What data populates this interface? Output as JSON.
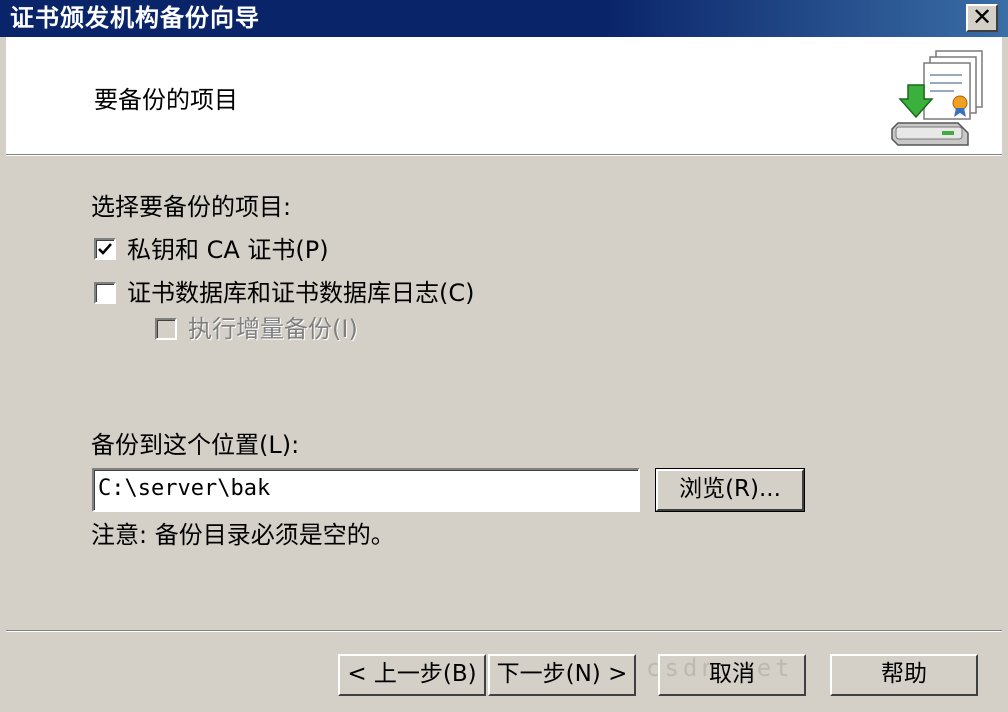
{
  "window": {
    "title": "证书颁发机构备份向导",
    "close_glyph": "✕"
  },
  "header": {
    "title": "要备份的项目",
    "icon": "certificate-backup-icon"
  },
  "items_section": {
    "prompt": "选择要备份的项目:",
    "options": [
      {
        "label": "私钥和 CA 证书(P)",
        "checked": true,
        "enabled": true
      },
      {
        "label": "证书数据库和证书数据库日志(C)",
        "checked": false,
        "enabled": true
      },
      {
        "label": "执行增量备份(I)",
        "checked": false,
        "enabled": false
      }
    ]
  },
  "location": {
    "label": "备份到这个位置(L):",
    "value": "C:\\server\\bak",
    "browse_label": "浏览(R)...",
    "note": "注意: 备份目录必须是空的。"
  },
  "footer": {
    "back_label": "< 上一步(B)",
    "next_label": "下一步(N) >",
    "cancel_label": "取消",
    "help_label": "帮助"
  },
  "watermark": "csdn.net"
}
